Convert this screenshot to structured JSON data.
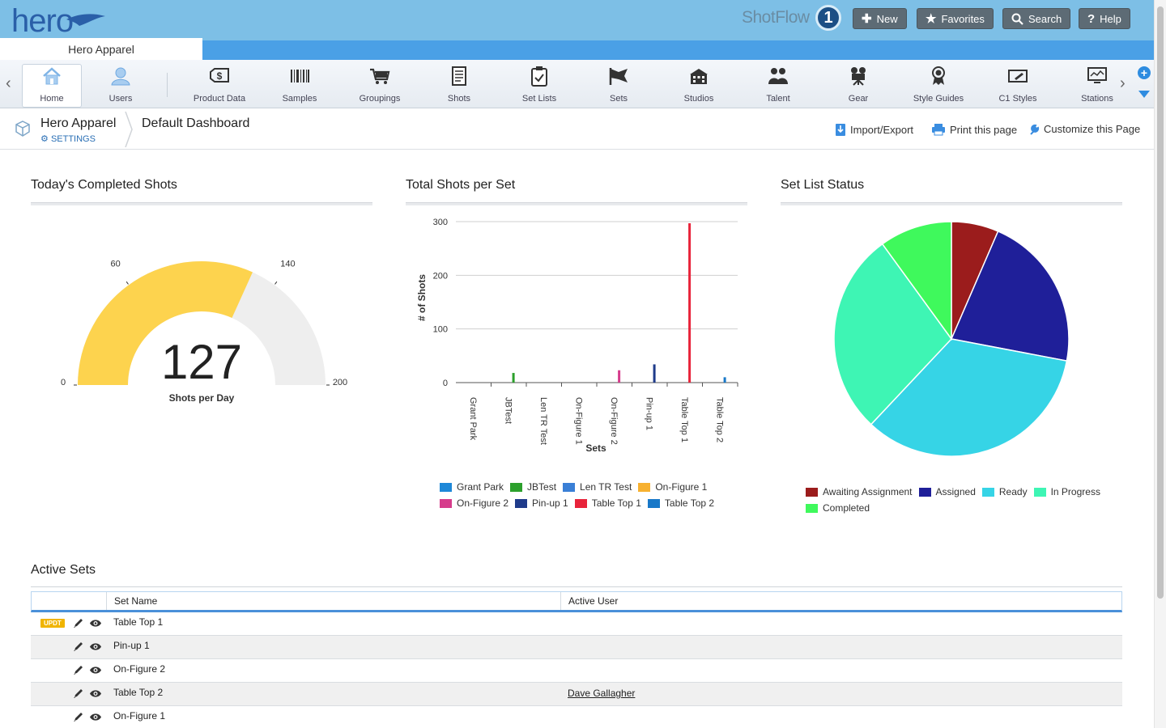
{
  "header": {
    "logo_text": "hero",
    "shotflow_text": "ShotFlow",
    "shotflow_badge": "1",
    "buttons": [
      {
        "label": "New",
        "icon": "plus-icon",
        "glyph": "✚"
      },
      {
        "label": "Favorites",
        "icon": "star-icon",
        "glyph": "★"
      },
      {
        "label": "Search",
        "icon": "search-icon",
        "glyph": "⚲"
      },
      {
        "label": "Help",
        "icon": "help-icon",
        "glyph": "?"
      }
    ],
    "account_tab": "Hero Apparel"
  },
  "toolbar": {
    "items": [
      {
        "label": "Home",
        "icon": "home-icon",
        "active": true
      },
      {
        "label": "Users",
        "icon": "user-icon"
      },
      {
        "label": "Product Data",
        "icon": "tag-icon"
      },
      {
        "label": "Samples",
        "icon": "barcode-icon"
      },
      {
        "label": "Groupings",
        "icon": "cart-icon"
      },
      {
        "label": "Shots",
        "icon": "document-icon"
      },
      {
        "label": "Set Lists",
        "icon": "clipboard-icon"
      },
      {
        "label": "Sets",
        "icon": "flag-icon"
      },
      {
        "label": "Studios",
        "icon": "building-icon"
      },
      {
        "label": "Talent",
        "icon": "people-icon"
      },
      {
        "label": "Gear",
        "icon": "camera-icon"
      },
      {
        "label": "Style Guides",
        "icon": "award-icon"
      },
      {
        "label": "C1 Styles",
        "icon": "edit-box-icon"
      },
      {
        "label": "Stations",
        "icon": "monitor-icon"
      }
    ]
  },
  "breadcrumb": {
    "org": "Hero Apparel",
    "settings": "SETTINGS",
    "dashboard": "Default Dashboard",
    "actions": [
      {
        "label": "Import/Export",
        "icon": "import-icon"
      },
      {
        "label": "Print this page",
        "icon": "printer-icon"
      },
      {
        "label": "Customize this Page",
        "icon": "wrench-icon"
      }
    ]
  },
  "gauge": {
    "title": "Today's Completed Shots",
    "value": "127",
    "value_num": 127,
    "label": "Shots per Day",
    "min": "0",
    "max": "200",
    "min_num": 0,
    "max_num": 200,
    "tick_low": "60",
    "tick_high": "140",
    "tick_low_num": 60,
    "tick_high_num": 140,
    "fill_color": "#fdd34e",
    "track_color": "#eeeeee"
  },
  "bar_chart": {
    "title": "Total Shots per Set",
    "chart_data": {
      "type": "bar",
      "xlabel": "Sets",
      "ylabel": "# of Shots",
      "ylim": [
        0,
        300
      ],
      "yticks": [
        "0",
        "100",
        "200",
        "300"
      ],
      "categories": [
        "Grant Park",
        "JBTest",
        "Len TR Test",
        "On-Figure 1",
        "On-Figure 2",
        "Pin-up 1",
        "Table Top 1",
        "Table Top 2"
      ],
      "values": [
        0,
        18,
        0,
        0,
        23,
        34,
        297,
        10
      ],
      "colors": [
        "#1e88d8",
        "#2ca02c",
        "#3a7fd6",
        "#f7b130",
        "#d63c8c",
        "#1f3b8a",
        "#e8233a",
        "#1878c8"
      ],
      "grid": true,
      "legend_position": "bottom"
    }
  },
  "pie_chart": {
    "title": "Set List Status",
    "chart_data": {
      "type": "pie",
      "labels": [
        "Awaiting Assignment",
        "Assigned",
        "Ready",
        "In Progress",
        "Completed"
      ],
      "values": [
        6.5,
        21.5,
        34,
        28,
        10
      ],
      "colors": [
        "#9b1c1c",
        "#1f1f99",
        "#36d4e6",
        "#3ef5b4",
        "#3ff95c"
      ],
      "legend_position": "bottom"
    }
  },
  "active_sets": {
    "title": "Active Sets",
    "columns": [
      "Set Name",
      "Active User"
    ],
    "badge": "UPDT",
    "rows": [
      {
        "name": "Table Top 1",
        "user": "",
        "updated": true
      },
      {
        "name": "Pin-up 1",
        "user": ""
      },
      {
        "name": "On-Figure 2",
        "user": ""
      },
      {
        "name": "Table Top 2",
        "user": "Dave Gallagher"
      },
      {
        "name": "On-Figure 1",
        "user": ""
      }
    ]
  }
}
